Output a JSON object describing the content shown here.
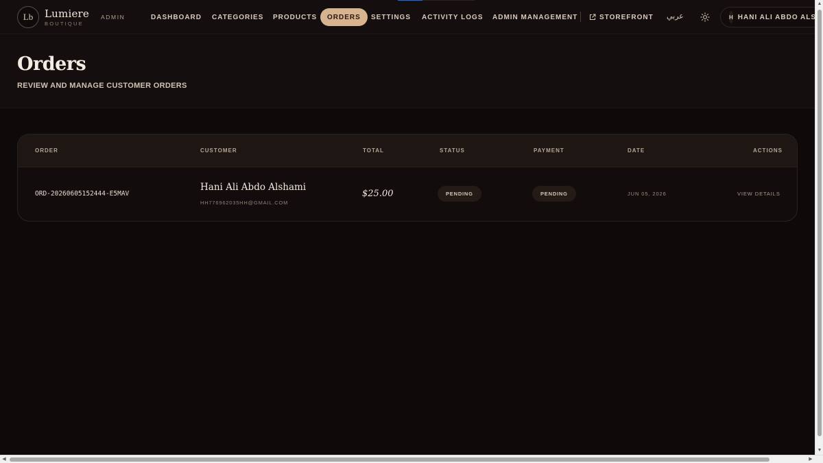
{
  "header": {
    "brand_initials": "Lb",
    "brand_name": "Lumiere",
    "brand_sub": "BOUTIQUE",
    "admin_tag": "ADMIN",
    "nav": {
      "dashboard": "DASHBOARD",
      "categories": "CATEGORIES",
      "products": "PRODUCTS",
      "orders": "ORDERS",
      "settings": "SETTINGS",
      "activity_logs": "ACTIVITY LOGS",
      "admin_management": "ADMIN MANAGEMENT",
      "storefront": "STOREFRONT"
    },
    "active_nav": "orders",
    "language_toggle": "عربي",
    "user_initial": "H",
    "user_name": "HANI ALI ABDO ALSHAMI"
  },
  "page": {
    "title": "Orders",
    "subtitle": "REVIEW AND MANAGE CUSTOMER ORDERS"
  },
  "table": {
    "columns": {
      "order": "ORDER",
      "customer": "CUSTOMER",
      "total": "TOTAL",
      "status": "STATUS",
      "payment": "PAYMENT",
      "date": "DATE",
      "actions": "ACTIONS"
    },
    "rows": [
      {
        "order_id": "ORD-20260605152444-E5MAV",
        "customer_name": "Hani Ali Abdo Alshami",
        "customer_email": "HH776962035HH@GMAIL.COM",
        "total": "$25.00",
        "status": "PENDING",
        "payment": "PENDING",
        "date": "JUN 05, 2026",
        "action": "VIEW DETAILS"
      }
    ]
  },
  "colors": {
    "accent": "#d5b48f",
    "background": "#0e0a09",
    "surface": "#140f0e"
  }
}
